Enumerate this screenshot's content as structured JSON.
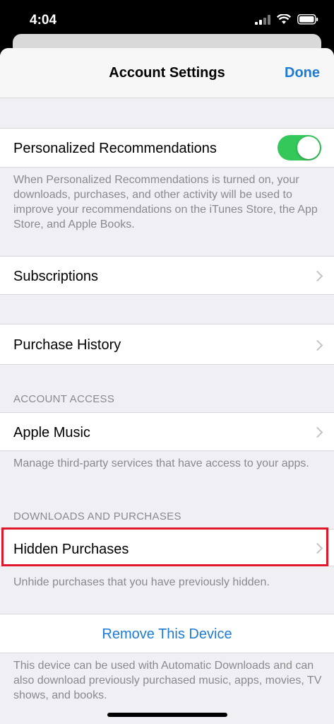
{
  "status_bar": {
    "time": "4:04",
    "icons": [
      "cellular-signal-icon",
      "wifi-icon",
      "battery-icon"
    ]
  },
  "nav": {
    "title": "Account Settings",
    "done_label": "Done"
  },
  "personalized": {
    "label": "Personalized Recommendations",
    "toggle_on": true,
    "footer": "When Personalized Recommendations is turned on, your downloads, purchases, and other activity will be used to improve your recommendations on the iTunes Store, the App Store, and Apple Books."
  },
  "subscriptions": {
    "label": "Subscriptions"
  },
  "purchase_history": {
    "label": "Purchase History"
  },
  "account_access": {
    "header": "ACCOUNT ACCESS",
    "apple_music_label": "Apple Music",
    "footer": "Manage third-party services that have access to your apps."
  },
  "downloads": {
    "header": "DOWNLOADS AND PURCHASES",
    "hidden_purchases_label": "Hidden Purchases",
    "footer": "Unhide purchases that you have previously hidden."
  },
  "remove_device": {
    "label": "Remove This Device",
    "footer": "This device can be used with Automatic Downloads and can also download previously purchased music, apps, movies, TV shows, and books."
  },
  "colors": {
    "accent": "#1c7cd5",
    "toggle_on": "#34c759",
    "highlight": "#e0162b"
  }
}
